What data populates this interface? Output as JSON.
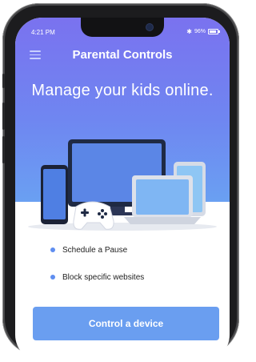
{
  "status_bar": {
    "time": "4:21 PM",
    "battery_percent": "96%"
  },
  "header": {
    "title": "Parental Controls"
  },
  "hero": {
    "headline": "Manage your kids online."
  },
  "features": [
    {
      "label": "Schedule a Pause"
    },
    {
      "label": "Block specific websites"
    }
  ],
  "cta": {
    "label": "Control a device"
  },
  "colors": {
    "hero_gradient_top": "#7a72ef",
    "hero_gradient_bottom": "#6aa0f2",
    "accent": "#6a9ef0",
    "bullet": "#5f8ef0"
  },
  "icons": [
    "menu-icon",
    "bluetooth-icon",
    "battery-icon"
  ]
}
